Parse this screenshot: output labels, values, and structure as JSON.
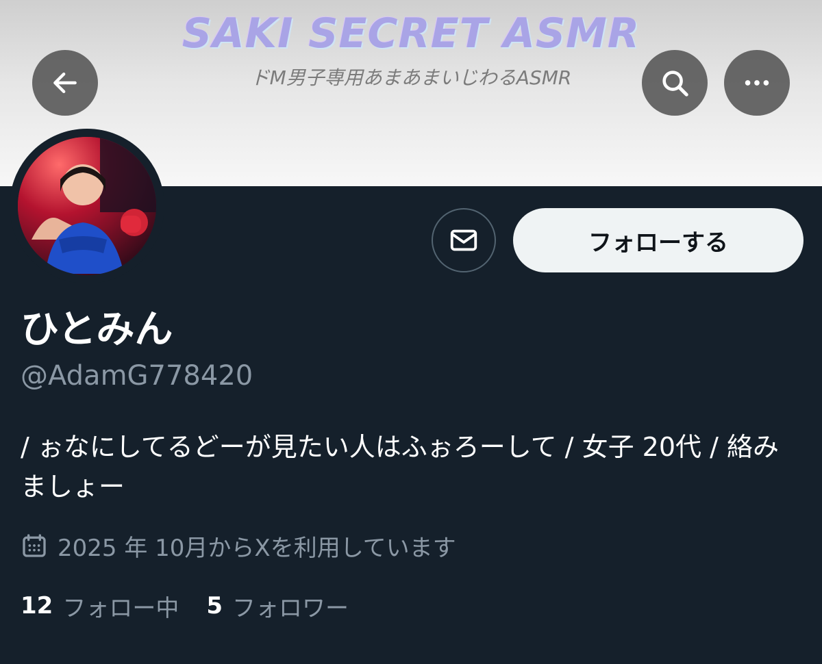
{
  "banner": {
    "title": "SAKI SECRET ASMR",
    "subtitle": "ドM男子専用あまあまいじわるASMR"
  },
  "nav": {
    "back_icon": "arrow-left-icon",
    "search_icon": "search-icon",
    "more_icon": "more-horizontal-icon"
  },
  "profile": {
    "display_name": "ひとみん",
    "handle": "@AdamG778420",
    "bio": "/ ぉなにしてるどーが見たい人はふぉろーして / 女子 20代 / 絡みましょー",
    "joined": "2025 年 10月からXを利用しています",
    "joined_icon": "calendar-icon"
  },
  "actions": {
    "message_icon": "mail-icon",
    "follow_label": "フォローする"
  },
  "stats": {
    "following_count": "12",
    "following_label": "フォロー中",
    "followers_count": "5",
    "followers_label": "フォロワー"
  },
  "colors": {
    "background": "#15202b",
    "secondary_text": "#8b98a5",
    "follow_button_bg": "#eff3f4"
  }
}
